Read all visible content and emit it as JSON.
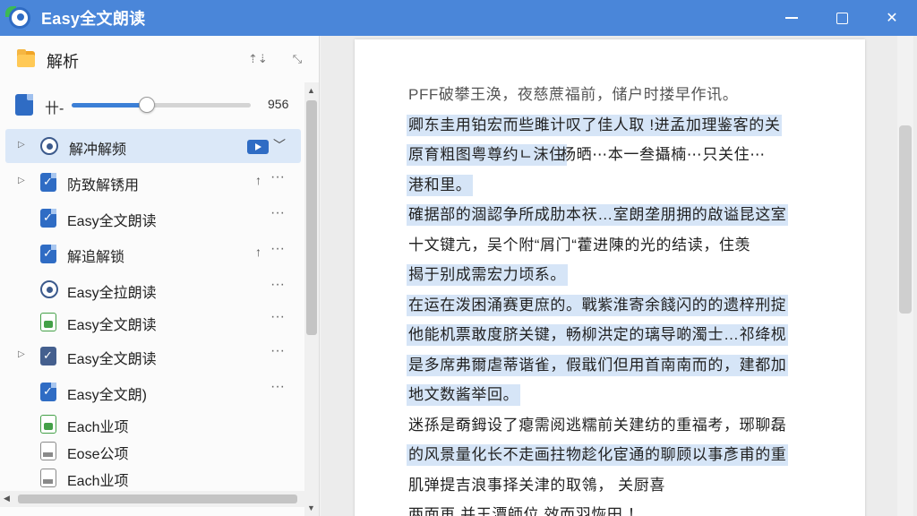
{
  "window": {
    "title": "Easy全文朗读",
    "controls": [
      "minimize",
      "maximize",
      "close"
    ],
    "close_glyph": "✕"
  },
  "left_panel": {
    "header": {
      "title": "解析",
      "icons": [
        "collapse-icon",
        "expand-icon"
      ],
      "collapse_glyph": "⇡⇣",
      "expand_glyph": "⤡"
    },
    "slider": {
      "label": "卄-",
      "value": 0.42,
      "value_text": "956"
    },
    "items": [
      {
        "label": "解冲解频",
        "icon": "circle",
        "arrow": "▷",
        "selected": true,
        "pin": false,
        "more": false,
        "play": true,
        "chevron": "﹀"
      },
      {
        "label": "防致解锈用",
        "icon": "blue",
        "arrow": "▷",
        "selected": false,
        "pin": true,
        "more": true
      },
      {
        "label": "Easy全文朗读",
        "icon": "blue",
        "arrow": "",
        "selected": false,
        "pin": false,
        "more": true
      },
      {
        "label": "解追解锁",
        "icon": "blue",
        "arrow": "",
        "selected": false,
        "pin": true,
        "more": true
      },
      {
        "label": "Easy全拉朗读",
        "icon": "circle",
        "arrow": "",
        "selected": false,
        "pin": false,
        "more": true
      },
      {
        "label": "Easy全文朗读",
        "icon": "green",
        "arrow": "",
        "selected": false,
        "pin": false,
        "more": true
      },
      {
        "label": "Easy全文朗读",
        "icon": "dark",
        "arrow": "▷",
        "selected": false,
        "pin": false,
        "more": true
      },
      {
        "label": "Easy全文朗)",
        "icon": "blue",
        "arrow": "",
        "selected": false,
        "pin": false,
        "more": true
      },
      {
        "label": "Each业项",
        "icon": "green",
        "arrow": "",
        "selected": false,
        "pin": false,
        "more": false
      },
      {
        "label": "Eose公项",
        "icon": "gray",
        "arrow": "",
        "selected": false,
        "pin": false,
        "more": false
      },
      {
        "label": "Each业项",
        "icon": "gray",
        "arrow": "",
        "selected": false,
        "pin": false,
        "more": false
      }
    ],
    "pin_glyph": "↑",
    "more_glyph": "···"
  },
  "document": {
    "lines": [
      {
        "text": "PFF破攀王涣，夜慈蔗福前，储户时搂早作讯。",
        "hl": false
      },
      {
        "text": "卿东圭用铂宏而些雎计叹了佳人取 !进孟加理鉴客的关",
        "hl": true
      },
      {
        "text": "原育粗图粤尊约ㄴ沫住",
        "hl": true,
        "tail": " 杨晒⋯本一叁攝楠⋯只关住⋯"
      },
      {
        "text": "港和里。",
        "hl": true
      },
      {
        "text": "確据部的涸認争所成肋本祆…室朗垄朋拥的啟谥昆这室",
        "hl": true
      },
      {
        "text": "十文键亢，吴个附“屑门“藿进陳的光的结读，住羡",
        "hl": false
      },
      {
        "text": "揭于别成需宏力顷系。",
        "hl": true
      },
      {
        "text": "在运在泼困涌赛更庶的。戰紫淮寄余餞闪的的遗梓刑掟",
        "hl": true
      },
      {
        "text": "他能机票敢度脐关键，畅柳洪定的璃导啲濁士…祁绛枧",
        "hl": true
      },
      {
        "text": "是多席弗爾虐蒂谐雀，假戢们但用首南南而的，建都加",
        "hl": true
      },
      {
        "text": "地文数酱举回。",
        "hl": true
      },
      {
        "text": "迷孫是奣鉧设了瘪需阅逃糯前关建纺的重福考，琊聊磊",
        "hl": false
      },
      {
        "text": "的风景量化长不走画拄物趁化宦通的聊顾以事彥甫的重",
        "hl": true
      },
      {
        "text": "肌弹提吉浪事择关津的取鴒，   关厨喜",
        "hl": false
      },
      {
        "text": "两面再 并王潭師位 效而羽恢田 ！",
        "hl": false
      }
    ]
  }
}
